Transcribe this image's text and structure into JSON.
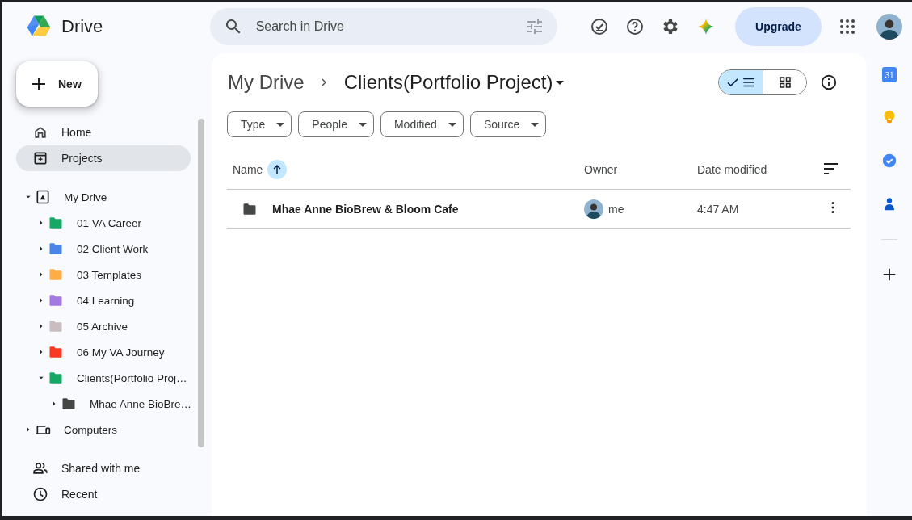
{
  "app": {
    "name": "Drive"
  },
  "search": {
    "placeholder": "Search in Drive"
  },
  "upgrade": "Upgrade",
  "new_button": "New",
  "nav_top": [
    {
      "label": "Home",
      "selected": false
    },
    {
      "label": "Projects",
      "selected": true
    }
  ],
  "tree": [
    {
      "label": "My Drive",
      "expanded": true,
      "children": [
        {
          "label": "01 VA Career",
          "color": "#16a765",
          "expanded": false
        },
        {
          "label": "02 Client Work",
          "color": "#4a86e8",
          "expanded": false
        },
        {
          "label": "03 Templates",
          "color": "#ffad47",
          "expanded": false
        },
        {
          "label": "04 Learning",
          "color": "#a47ae2",
          "expanded": false
        },
        {
          "label": "05 Archive",
          "color": "#cabdbf",
          "expanded": false
        },
        {
          "label": "06 My VA Journey",
          "color": "#f83a22",
          "expanded": false
        },
        {
          "label": "Clients(Portfolio Proj…",
          "color": "#16a765",
          "expanded": true,
          "children": [
            {
              "label": "Mhae Anne BioBre…",
              "color": "#444746",
              "expanded": false
            }
          ]
        }
      ]
    },
    {
      "label": "Computers",
      "expanded": false
    }
  ],
  "nav_bottom": [
    {
      "label": "Shared with me"
    },
    {
      "label": "Recent"
    }
  ],
  "breadcrumb": [
    {
      "label": "My Drive"
    },
    {
      "label": "Clients(Portfolio Project)"
    }
  ],
  "view_toggle": [
    {
      "kind": "list",
      "selected": true
    },
    {
      "kind": "grid",
      "selected": false
    }
  ],
  "filters": [
    "Type",
    "People",
    "Modified",
    "Source"
  ],
  "table": {
    "columns": [
      {
        "label": "Name",
        "sorted": true
      },
      {
        "label": "Owner",
        "sorted": false
      },
      {
        "label": "Date modified",
        "sorted": false
      }
    ],
    "rows": [
      {
        "name": "Mhae Anne BioBrew & Bloom Cafe",
        "owner": "me",
        "modified": "4:47 AM"
      }
    ]
  },
  "side_panel": {
    "calendar_day": "31"
  }
}
